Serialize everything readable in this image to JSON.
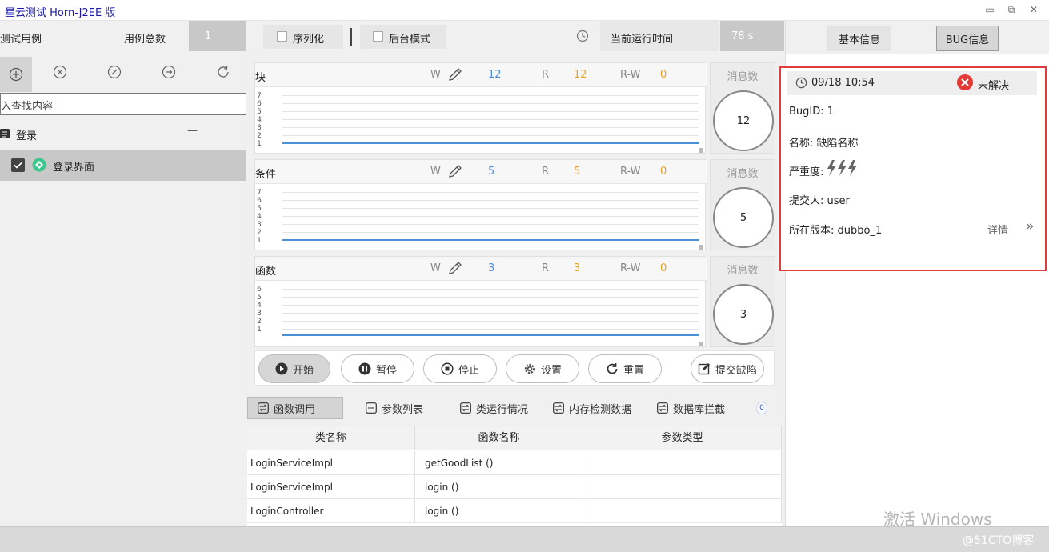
{
  "window": {
    "title": "星云测试 Horn-J2EE 版",
    "minimize": "▭",
    "restore": "⧉",
    "close": "✕"
  },
  "toolbar": {
    "cases_label": "测试用例",
    "total_label": "用例总数",
    "total_value": "1",
    "serialize_label": "序列化",
    "background_label": "后台模式",
    "runtime_label": "当前运行时间",
    "runtime_value": "78 s"
  },
  "left": {
    "search_placeholder": "入查找内容",
    "tree_group": "登录",
    "tree_group_collapse": "—",
    "tree_item": "登录界面",
    "icons": [
      "add-icon",
      "close-circle-icon",
      "edit-circle-icon",
      "arrow-right-circle-icon",
      "refresh-icon"
    ]
  },
  "panels": [
    {
      "title": "块",
      "w_label": "W",
      "w_value": "12",
      "r_label": "R",
      "r_value": "12",
      "rw_label": "R-W",
      "rw_value": "0",
      "msg_title": "消息数",
      "msg_value": "12"
    },
    {
      "title": "条件",
      "w_label": "W",
      "w_value": "5",
      "r_label": "R",
      "r_value": "5",
      "rw_label": "R-W",
      "rw_value": "0",
      "msg_title": "消息数",
      "msg_value": "5"
    },
    {
      "title": "函数",
      "w_label": "W",
      "w_value": "3",
      "r_label": "R",
      "r_value": "3",
      "rw_label": "R-W",
      "rw_value": "0",
      "msg_title": "消息数",
      "msg_value": "3"
    }
  ],
  "ticks": [
    "7",
    "6",
    "5",
    "4",
    "3",
    "2",
    "1"
  ],
  "actions": {
    "start": "开始",
    "pause": "暂停",
    "stop": "停止",
    "settings": "设置",
    "reset": "重置",
    "submit_bug": "提交缺陷"
  },
  "bottom_tabs": [
    "函数调用",
    "参数列表",
    "类运行情况",
    "内存检测数据",
    "数据库拦截"
  ],
  "bottom_tabs_extra": "0",
  "table": {
    "headers": [
      "类名称",
      "函数名称",
      "参数类型"
    ],
    "rows": [
      [
        "LoginServiceImpl",
        "getGoodList ()",
        ""
      ],
      [
        "LoginServiceImpl",
        "login ()",
        ""
      ],
      [
        "LoginController",
        "login ()",
        ""
      ]
    ]
  },
  "right": {
    "tab_basic": "基本信息",
    "tab_bug": "BUG信息",
    "bug": {
      "time": "09/18 10:54",
      "status": "未解决",
      "id_label": "BugID:",
      "id_value": "1",
      "name_label": "名称:",
      "name_value": "缺陷名称",
      "severity_label": "严重度:",
      "submitter_label": "提交人:",
      "submitter_value": "user",
      "version_label": "所在版本:",
      "version_value": "dubbo_1",
      "detail_link": "详情",
      "detail_arrow": "»"
    }
  },
  "watermark": "激活 Windows",
  "credit": "@51CTO博客",
  "colors": {
    "accent_blue": "#4a90d9",
    "accent_orange": "#f0a020",
    "highlight_red": "#e03c3c"
  }
}
